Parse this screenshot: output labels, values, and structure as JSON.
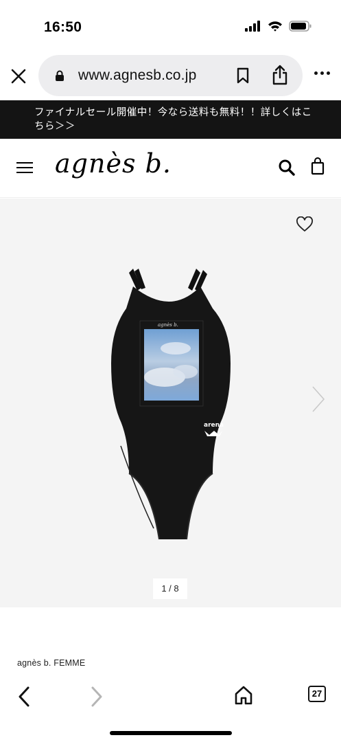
{
  "status": {
    "time": "16:50"
  },
  "browser": {
    "url": "www.agnesb.co.jp"
  },
  "banner": {
    "text": "ファイナルセール開催中！今なら送料も無料！！詳しくはこちら＞＞"
  },
  "header": {
    "logo": "agnès b."
  },
  "gallery": {
    "page_indicator": "1 / 8",
    "print_brand_label": "agnès b.",
    "swimsuit_brand_label": "arena"
  },
  "product": {
    "brand": "agnès b. FEMME"
  },
  "toolbar": {
    "tab_count": "27"
  }
}
